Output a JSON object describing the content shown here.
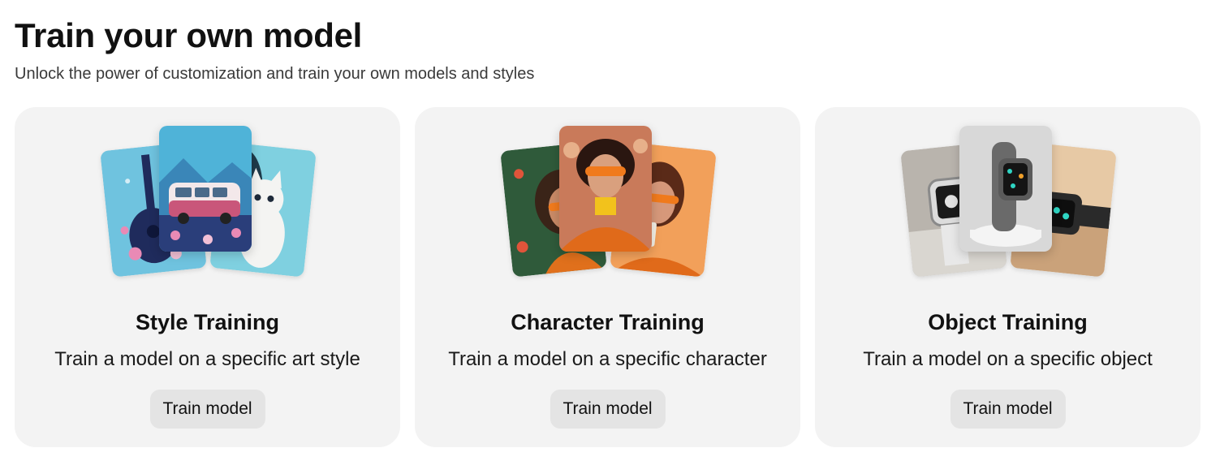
{
  "header": {
    "title": "Train your own model",
    "subtitle": "Unlock the power of customization and train your own models and styles"
  },
  "cards": [
    {
      "title": "Style Training",
      "description": "Train a model on a specific art style",
      "button_label": "Train model",
      "images": [
        "guitar-with-flowers-illustration",
        "pink-van-illustration",
        "white-cat-illustration"
      ]
    },
    {
      "title": "Character Training",
      "description": "Train a model on a specific character",
      "button_label": "Train model",
      "images": [
        "woman-orange-glasses-portrait",
        "woman-orange-glasses-portrait",
        "woman-orange-glasses-drinking-portrait"
      ]
    },
    {
      "title": "Object Training",
      "description": "Train a model on a specific object",
      "button_label": "Train model",
      "images": [
        "smartwatch-photo",
        "smartwatch-on-stand-photo",
        "smartwatch-on-wood-photo"
      ]
    }
  ]
}
